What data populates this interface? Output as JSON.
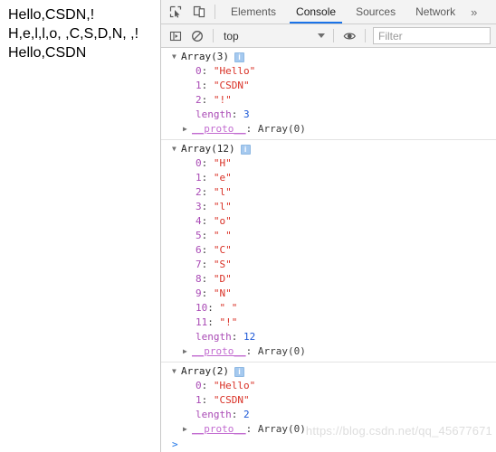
{
  "page": {
    "lines": [
      "Hello,CSDN,!",
      "H,e,l,l,o, ,C,S,D,N, ,!",
      "Hello,CSDN"
    ]
  },
  "devtools": {
    "toolbar": {
      "inspect_icon": "inspect-element-icon",
      "device_icon": "device-toolbar-icon",
      "tabs": [
        {
          "label": "Elements",
          "active": false
        },
        {
          "label": "Console",
          "active": true
        },
        {
          "label": "Sources",
          "active": false
        },
        {
          "label": "Network",
          "active": false
        }
      ],
      "more_label": "»",
      "active_tab_color": "#1a73e8"
    },
    "console_toolbar": {
      "sidebar_icon": "console-sidebar-icon",
      "clear_icon": "clear-console-icon",
      "context_value": "top",
      "context_caret": "chevron-down-icon",
      "eye_icon": "live-expression-eye-icon",
      "filter_placeholder": "Filter"
    },
    "prompt": ">",
    "watermark": "https://blog.csdn.net/qq_45677671",
    "groups": [
      {
        "header": "Array(3)",
        "disclosure": "▼",
        "info": "i",
        "props": [
          {
            "key": "0",
            "key_type": "index",
            "value": "\"Hello\"",
            "value_type": "string"
          },
          {
            "key": "1",
            "key_type": "index",
            "value": "\"CSDN\"",
            "value_type": "string"
          },
          {
            "key": "2",
            "key_type": "index",
            "value": "\"!\"",
            "value_type": "string"
          },
          {
            "key": "length",
            "key_type": "length",
            "value": "3",
            "value_type": "number"
          }
        ],
        "proto": {
          "disclosure": "▶",
          "key": "__proto__",
          "value": "Array(0)"
        }
      },
      {
        "header": "Array(12)",
        "disclosure": "▼",
        "info": "i",
        "props": [
          {
            "key": "0",
            "key_type": "index",
            "value": "\"H\"",
            "value_type": "string"
          },
          {
            "key": "1",
            "key_type": "index",
            "value": "\"e\"",
            "value_type": "string"
          },
          {
            "key": "2",
            "key_type": "index",
            "value": "\"l\"",
            "value_type": "string"
          },
          {
            "key": "3",
            "key_type": "index",
            "value": "\"l\"",
            "value_type": "string"
          },
          {
            "key": "4",
            "key_type": "index",
            "value": "\"o\"",
            "value_type": "string"
          },
          {
            "key": "5",
            "key_type": "index",
            "value": "\" \"",
            "value_type": "string"
          },
          {
            "key": "6",
            "key_type": "index",
            "value": "\"C\"",
            "value_type": "string"
          },
          {
            "key": "7",
            "key_type": "index",
            "value": "\"S\"",
            "value_type": "string"
          },
          {
            "key": "8",
            "key_type": "index",
            "value": "\"D\"",
            "value_type": "string"
          },
          {
            "key": "9",
            "key_type": "index",
            "value": "\"N\"",
            "value_type": "string"
          },
          {
            "key": "10",
            "key_type": "index",
            "value": "\" \"",
            "value_type": "string"
          },
          {
            "key": "11",
            "key_type": "index",
            "value": "\"!\"",
            "value_type": "string"
          },
          {
            "key": "length",
            "key_type": "length",
            "value": "12",
            "value_type": "number"
          }
        ],
        "proto": {
          "disclosure": "▶",
          "key": "__proto__",
          "value": "Array(0)"
        }
      },
      {
        "header": "Array(2)",
        "disclosure": "▼",
        "info": "i",
        "props": [
          {
            "key": "0",
            "key_type": "index",
            "value": "\"Hello\"",
            "value_type": "string"
          },
          {
            "key": "1",
            "key_type": "index",
            "value": "\"CSDN\"",
            "value_type": "string"
          },
          {
            "key": "length",
            "key_type": "length",
            "value": "2",
            "value_type": "number"
          }
        ],
        "proto": {
          "disclosure": "▶",
          "key": "__proto__",
          "value": "Array(0)"
        }
      }
    ]
  }
}
